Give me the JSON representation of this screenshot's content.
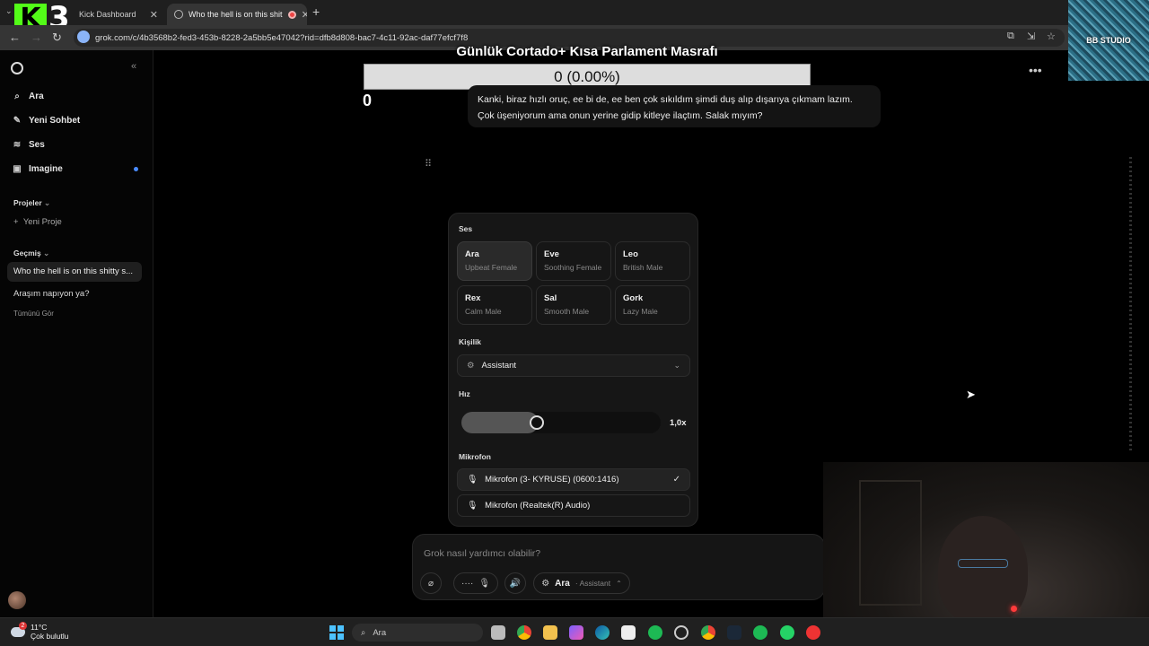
{
  "browser": {
    "tabs": [
      {
        "label": "Kick Dashboard"
      },
      {
        "label": "Who the hell is on this shit"
      }
    ],
    "url": "grok.com/c/4b3568b2-fed3-453b-8228-2a5bb5e47042?rid=dfb8d808-bac7-4c11-92ac-daf77efcf7f8",
    "new_tab": "+",
    "stream_brand": "BB STUDIO",
    "kick_logo_letter": "K",
    "kick_logo_number": "3"
  },
  "sidebar": {
    "items": [
      {
        "label": "Ara",
        "icon": "search-icon"
      },
      {
        "label": "Yeni Sohbet",
        "icon": "edit-icon"
      },
      {
        "label": "Ses",
        "icon": "voice-wave-icon"
      },
      {
        "label": "Imagine",
        "icon": "image-icon"
      }
    ],
    "projects_label": "Projeler",
    "new_project": "Yeni Proje",
    "history_label": "Geçmiş",
    "history": [
      "Who the hell is on this shitty s...",
      "Araşım napıyon ya?"
    ],
    "see_all": "Tümünü Gör"
  },
  "overlay": {
    "title": "Günlük Cortado+ Kısa Parlament Masrafı",
    "amount": "0 (0.00%)",
    "count": "0"
  },
  "chat": {
    "message_line1": "Kanki, biraz hızlı oruç, ee bi de, ee ben çok sıkıldım şimdi duş alıp dışarıya çıkmam lazım.",
    "message_line2": "Çok üşeniyorum ama onun yerine gidip kitleye ilaçtım. Salak mıyım?"
  },
  "voice_panel": {
    "voice_label": "Ses",
    "voices": [
      {
        "name": "Ara",
        "desc": "Upbeat Female",
        "selected": true
      },
      {
        "name": "Eve",
        "desc": "Soothing Female",
        "selected": false
      },
      {
        "name": "Leo",
        "desc": "British Male",
        "selected": false
      },
      {
        "name": "Rex",
        "desc": "Calm Male",
        "selected": false
      },
      {
        "name": "Sal",
        "desc": "Smooth Male",
        "selected": false
      },
      {
        "name": "Gork",
        "desc": "Lazy Male",
        "selected": false
      }
    ],
    "personality_label": "Kişilik",
    "personality_value": "Assistant",
    "speed_label": "Hız",
    "speed_value": "1,0x",
    "speed_fraction": 0.35,
    "mic_label": "Mikrofon",
    "mics": [
      {
        "label": "Mikrofon (3- KYRUSE) (0600:1416)",
        "selected": true
      },
      {
        "label": "Mikrofon (Realtek(R) Audio)",
        "selected": false
      }
    ]
  },
  "composer": {
    "placeholder": "Grok nasıl yardımcı olabilir?",
    "voice_name": "Ara",
    "persona": "· Assistant"
  },
  "taskbar": {
    "temp": "11°C",
    "weather": "Çok bulutlu",
    "notification_count": "2",
    "search": "Ara"
  }
}
